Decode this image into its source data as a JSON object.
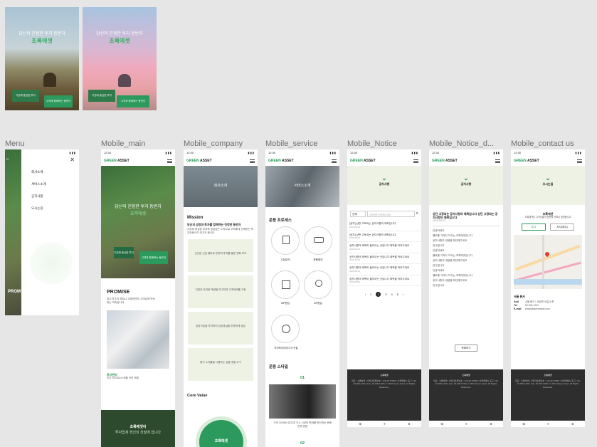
{
  "posters": [
    {
      "headline": "당신의 진정한 투자 동반자",
      "brand": "초록에셋",
      "btn1": "기존에 중심한 투자",
      "btn2": "고객과 함께하는 동반자"
    },
    {
      "headline": "당신의 진정한 투자 동반자",
      "brand": "초록에셋",
      "btn1": "기존에 중심한 투자",
      "btn2": "고객과 함께하는 동반자"
    }
  ],
  "frames": {
    "menu": "Menu",
    "main": "Mobile_main",
    "company": "Mobile_company",
    "service": "Mobile_service",
    "notice": "Mobile_Notice",
    "notice_detail": "Mobile_Notice_d...",
    "contact": "Mobile_contact us"
  },
  "status_time": "12:30",
  "logo": {
    "green": "GREEN",
    "rest": " ASSET"
  },
  "menu": {
    "items": [
      "회사소개",
      "서비스소개",
      "공지사항",
      "오시는길"
    ],
    "promise_stub": "PROM"
  },
  "main": {
    "hero_line1": "당신의 진정한 투자 동반자",
    "hero_line2": "초록에셋",
    "btn1": "기존에 중심한 투자",
    "btn2": "고객과 함께하는 동반자",
    "promise_title": "PROMISE",
    "promise_text": "최고의 투자 파트너 초록에셋의 고객님께 약속하는 약속입니다",
    "card_title": "투자관리",
    "card_text": "투자 리스트&스케줄 관리 체계",
    "bottom_line1": "초록에셋이",
    "bottom_line2": "투자업계 혁신의 선발에 섭니다"
  },
  "company": {
    "hero_label": "회사소개",
    "mission_title": "Mission",
    "mission_line": "당신의 성장과 투자를 함께하는 진정한 동반자",
    "mission_text": "기본에 충실한 투자와 끊임없는 노력으로 고객에게 신뢰받는 투자전문사가 되고자 합니다",
    "cards": [
      "신선한 신입 멤버로 전략적 투자를 통한 변화 모도",
      "지업과 유개한 역량을 보고하여 고객에게를 구현",
      "성장가능을 투자하여 성장과실을 투명하게 공유",
      "평가 수익률을 시행하는 상품 개발 주구"
    ],
    "core_title": "Core Value",
    "core_circle": "초록에셋"
  },
  "service": {
    "hero_label": "서비스소개",
    "process_title": "운용 프로세스",
    "steps": [
      "시장분석",
      "운용회의",
      "MP편입",
      "AP편입",
      "투자포지지/리스크 관찰"
    ],
    "style_title": "운용 스타일",
    "step01": "01",
    "style_text": "TOP-DOWN 분석과 거시 시장의 변화를 판단하는 운용 전략 방법",
    "step02": "02"
  },
  "notice": {
    "title": "공지사항",
    "select": "전체",
    "search_placeholder": "검색어를 입력해주세요",
    "rows": [
      {
        "title": "[공지] 상판 고토되는 공지사항의 제목입니다.",
        "date": "2023.05.02"
      },
      {
        "title": "[공지] 상판 고토되는 공지사항의 제목입니다.",
        "date": "2023.05.02"
      },
      {
        "title": "공지사항의 제목이 들어오는 곳입니다 제목을 적어주세요",
        "date": "2023.05.02"
      },
      {
        "title": "공지사항의 제목이 들어오는 곳입니다 제목을 적어주세요",
        "date": "2023.05.02"
      },
      {
        "title": "공지사항의 제목이 들어오는 곳입니다 제목을 적어주세요",
        "date": "2023.05.02"
      },
      {
        "title": "공지사항의 제목이 들어오는 곳입니다 제목을 적어주세요",
        "date": "2023.05.02"
      }
    ],
    "pages": [
      "1",
      "2",
      "3",
      "4",
      "5"
    ]
  },
  "notice_detail": {
    "title": "공지사항",
    "heading": "상단 고정되는 공지사항의 제목입니다 상단 고정되는 공지사항의 제목입니다",
    "date": "2023.05.02",
    "lines": [
      "안녕하세요",
      "헬로를 가져다 드리는 초록에셋입니다",
      "공지사항의 내용을 확인해주세요",
      "감사합니다",
      "안녕하세요",
      "헬로를 가져다 드리는 초록에셋입니다",
      "공지사항의 내용을 확인해주세요",
      "감사합니다",
      "안녕하세요",
      "헬로를 가져다 드리는 초록에셋입니다",
      "공지사항의 내용을 확인해주세요",
      "감사합니다"
    ],
    "list_btn": "목록보기"
  },
  "contact": {
    "title": "오시는길",
    "office": "초록에셋",
    "office_text": "초록에셋은 고객님들의 방문을 언제나 환영합니다",
    "btn1": "본사",
    "btn2": "지사(제주)",
    "branch_title": "서울 본사",
    "addr_label": "Add",
    "addr": "서울 중구 1 대로변 35길 8 층",
    "tel_label": "Tel",
    "tel": "02-000-1234",
    "mail_label": "E-mail",
    "mail": "email@greenasset.com"
  },
  "footer_title": "초록에셋",
  "footer_text": "대표 : 초록에셋 | 사업자등록번호 : 123-45-67890 | 서울특별시 중구 | Tel. 02-000-1234 | Fax. 02-000-1235 | © 2023 Green Asset. All Rights Reserved.",
  "colors": {
    "accent": "#2c9a5c",
    "mint": "#edf2e4",
    "footer": "#2e2e2e"
  }
}
